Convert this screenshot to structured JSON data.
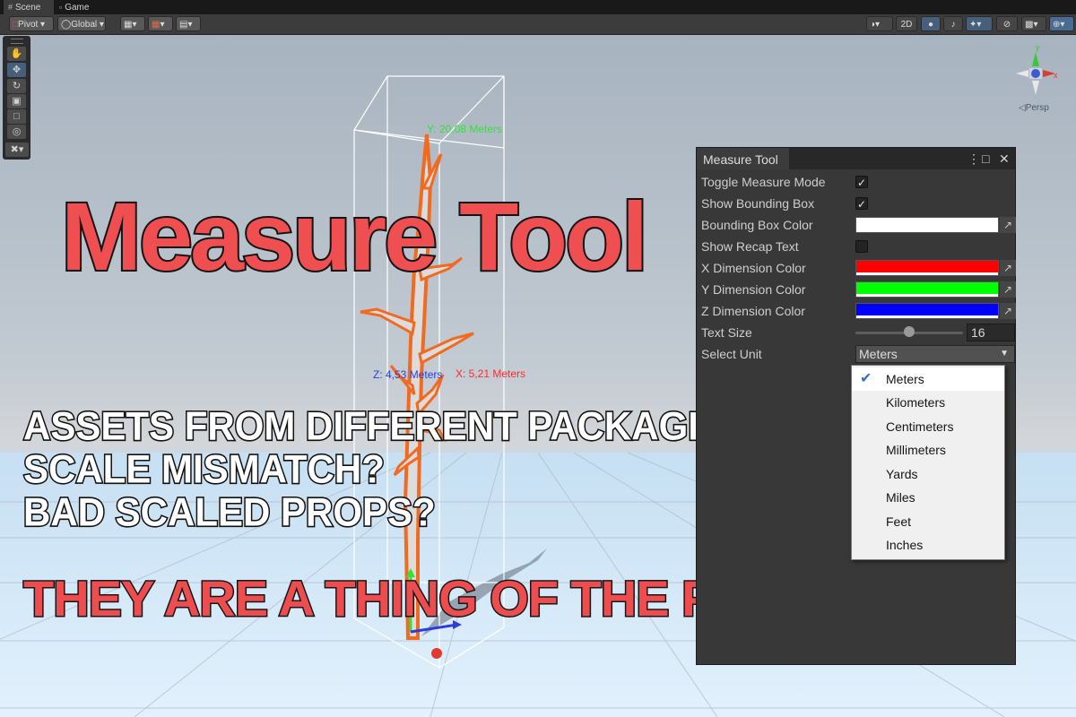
{
  "tabs": [
    {
      "label": "Scene",
      "icon": "scene-grid-icon"
    },
    {
      "label": "Game",
      "icon": "gamepad-icon"
    }
  ],
  "toolbar": {
    "pivot_label": "Pivot",
    "global_label": "Global",
    "mode_2d_label": "2D"
  },
  "view": {
    "projection_label": "◁Persp",
    "measurements": {
      "y": "Y: 20,08 Meters",
      "z": "Z: 4,53 Meters",
      "x": "X: 5,21 Meters"
    }
  },
  "overlay": {
    "title": "Measure Tool",
    "questions": [
      "ASSETS FROM DIFFERENT PACKAGES?",
      "SCALE MISMATCH?",
      "BAD SCALED PROPS?"
    ],
    "tagline": "THEY ARE A THING OF THE PAST!"
  },
  "panel": {
    "title": "Measure Tool",
    "fields": {
      "toggle_measure_mode": {
        "label": "Toggle Measure Mode",
        "checked": true
      },
      "show_bounding_box": {
        "label": "Show Bounding Box",
        "checked": true
      },
      "bounding_box_color": {
        "label": "Bounding Box Color",
        "color": "#ffffff"
      },
      "show_recap_text": {
        "label": "Show Recap Text",
        "checked": false
      },
      "x_dimension_color": {
        "label": "X Dimension Color",
        "color": "#ff0000"
      },
      "y_dimension_color": {
        "label": "Y Dimension Color",
        "color": "#00ff00"
      },
      "z_dimension_color": {
        "label": "Z Dimension Color",
        "color": "#0000ff"
      },
      "text_size": {
        "label": "Text Size",
        "value": "16"
      },
      "select_unit": {
        "label": "Select Unit",
        "value": "Meters"
      }
    },
    "check_glyph": "✓",
    "unit_options": [
      "Meters",
      "Kilometers",
      "Centimeters",
      "Millimeters",
      "Yards",
      "Miles",
      "Feet",
      "Inches"
    ],
    "selected_unit": "Meters"
  },
  "colors": {
    "title_red": "#ef4f50",
    "x_axis": "#ff2b2b",
    "y_axis": "#34e03a",
    "z_axis": "#2d3ddc",
    "selection_outline": "#f26a1f"
  }
}
